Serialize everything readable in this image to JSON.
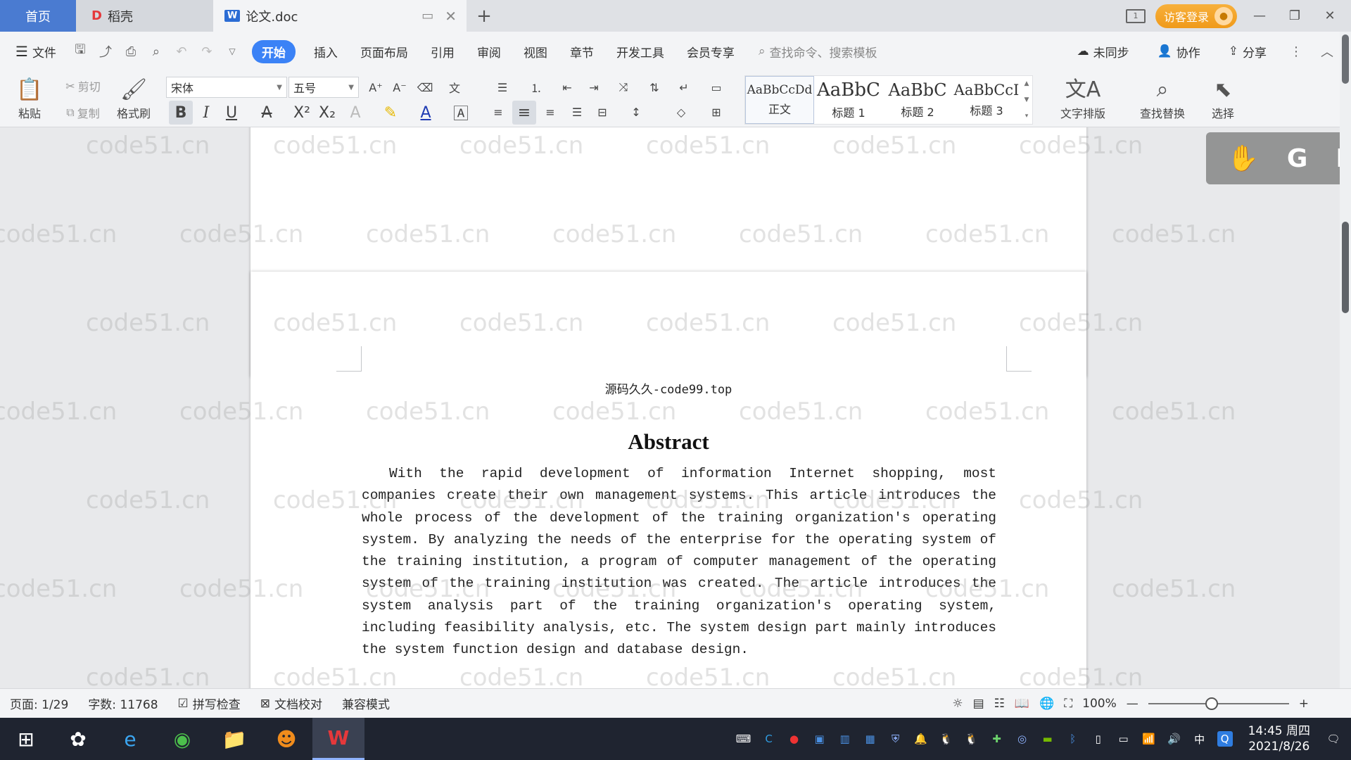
{
  "tabs": {
    "home": "首页",
    "daoke": "稻壳",
    "doc": "论文.doc",
    "new_tab": "+"
  },
  "titlebar": {
    "login": "访客登录"
  },
  "menu": {
    "file": "文件",
    "items": [
      "开始",
      "插入",
      "页面布局",
      "引用",
      "审阅",
      "视图",
      "章节",
      "开发工具",
      "会员专享"
    ],
    "active_index": 0,
    "search_placeholder": "查找命令、搜索模板",
    "sync": "未同步",
    "collab": "协作",
    "share": "分享"
  },
  "ribbon": {
    "paste": "粘贴",
    "cut": "剪切",
    "copy": "复制",
    "format_painter": "格式刷",
    "font_name": "宋体",
    "font_size": "五号",
    "styles": [
      {
        "sample": "AaBbCcDd",
        "name": "正文"
      },
      {
        "sample": "AaBbC",
        "name": "标题 1"
      },
      {
        "sample": "AaBbC",
        "name": "标题 2"
      },
      {
        "sample": "AaBbCcI",
        "name": "标题 3"
      }
    ],
    "text_layout": "文字排版",
    "find_replace": "查找替换",
    "select": "选择"
  },
  "document": {
    "header": "源码久久-code99.top",
    "title": "Abstract",
    "body": "With the rapid development of information Internet shopping, most companies create their own management systems. This article introduces the whole process of the development of the training organization's operating system. By analyzing the needs of the enterprise for the operating system of the training institution, a program of computer management of the operating system of the training institution was created. The article introduces the system analysis part of the training organization's operating system, including feasibility analysis, etc. The system design part mainly introduces the system function design and database design."
  },
  "watermark": "code51.cn",
  "float_toolbar": {
    "g": "G",
    "f": "F"
  },
  "status": {
    "page": "页面: 1/29",
    "words": "字数: 11768",
    "spell": "拼写检查",
    "proof": "文档校对",
    "compat": "兼容模式",
    "zoom": "100%",
    "zoom_level": 0.45
  },
  "taskbar": {
    "time": "14:45 周四",
    "date": "2021/8/26",
    "ime": "中"
  }
}
